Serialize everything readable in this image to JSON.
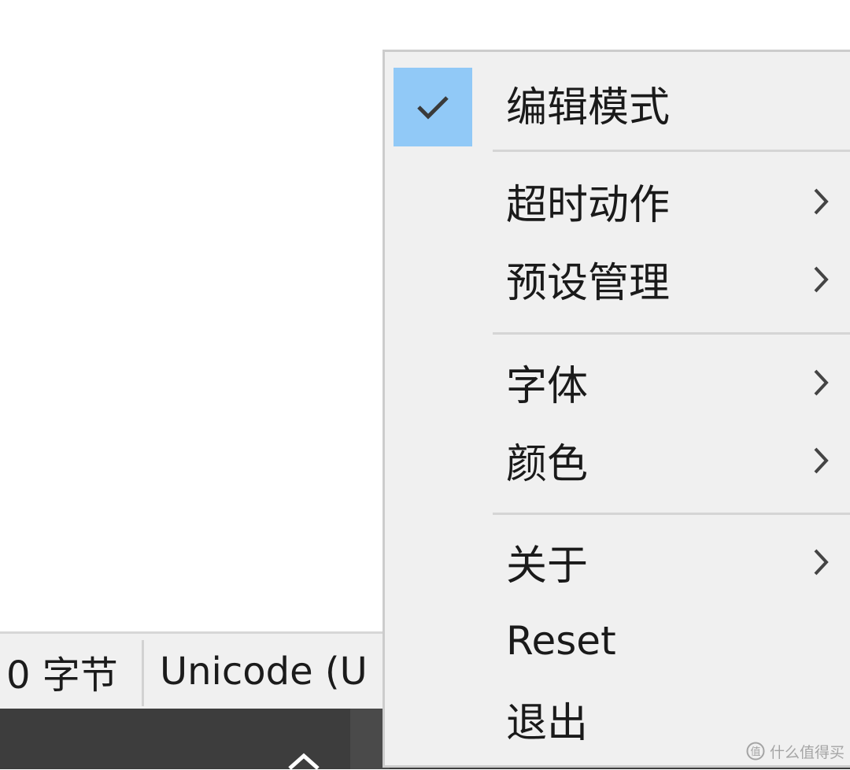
{
  "status_bar": {
    "byte_count": "0 字节",
    "encoding": "Unicode (U"
  },
  "context_menu": {
    "items": [
      {
        "label": "编辑模式",
        "checked": true,
        "has_submenu": false
      },
      {
        "label": "超时动作",
        "checked": false,
        "has_submenu": true
      },
      {
        "label": "预设管理",
        "checked": false,
        "has_submenu": true
      },
      {
        "label": "字体",
        "checked": false,
        "has_submenu": true
      },
      {
        "label": "颜色",
        "checked": false,
        "has_submenu": true
      },
      {
        "label": "关于",
        "checked": false,
        "has_submenu": true
      },
      {
        "label": "Reset",
        "checked": false,
        "has_submenu": false
      },
      {
        "label": "退出",
        "checked": false,
        "has_submenu": false
      }
    ],
    "check_color": "#91c9f7",
    "icons": {
      "check": "check-icon",
      "submenu": "chevron-right-icon"
    }
  },
  "taskbar": {
    "tray_icon": "chevron-up-icon"
  },
  "watermark": {
    "text": "什么值得买"
  }
}
